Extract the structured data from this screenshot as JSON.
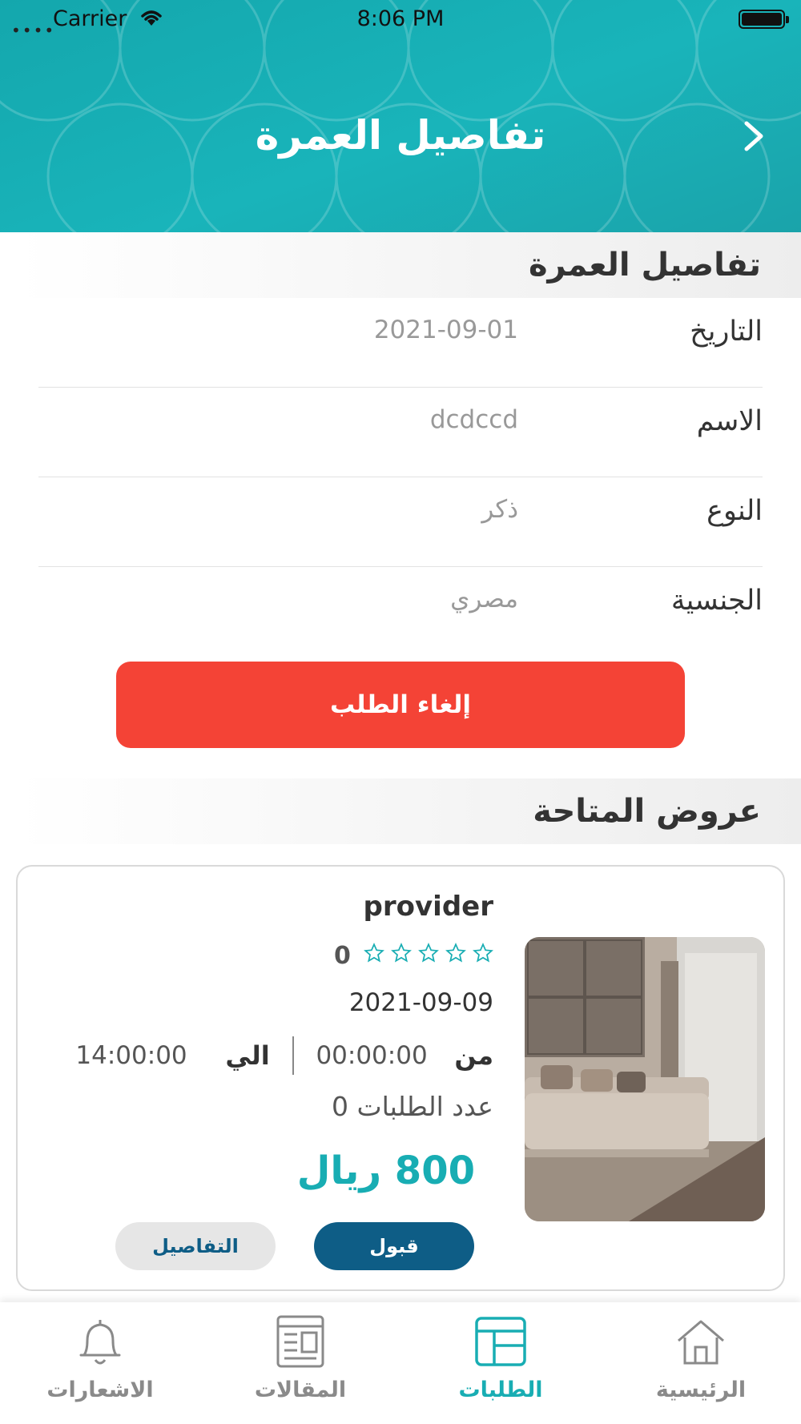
{
  "status_bar": {
    "carrier": "Carrier",
    "time": "8:06 PM"
  },
  "header": {
    "title": "تفاصيل العمرة"
  },
  "details_section": {
    "title": "تفاصيل العمرة",
    "rows": [
      {
        "label": "التاريخ",
        "value": "2021-09-01"
      },
      {
        "label": "الاسم",
        "value": "dcdccd"
      },
      {
        "label": "النوع",
        "value": "ذكر"
      },
      {
        "label": "الجنسية",
        "value": "مصري"
      }
    ],
    "cancel_label": "إلغاء الطلب"
  },
  "offers_section": {
    "title": "عروض المتاحة",
    "offer": {
      "provider": "provider",
      "rating": "0",
      "stars_filled": 0,
      "stars_total": 5,
      "date": "2021-09-09",
      "from_label": "من",
      "from_time": "00:00:00",
      "to_label": "الي",
      "to_time": "14:00:00",
      "requests_count": "عدد الطلبات 0",
      "price": "800 ريال",
      "accept_label": "قبول",
      "details_label": "التفاصيل"
    }
  },
  "tabbar": {
    "items": [
      {
        "label": "الرئيسية",
        "icon": "home-icon",
        "active": false
      },
      {
        "label": "الطلبات",
        "icon": "orders-icon",
        "active": true
      },
      {
        "label": "المقالات",
        "icon": "articles-icon",
        "active": false
      },
      {
        "label": "الاشعارات",
        "icon": "bell-icon",
        "active": false
      }
    ]
  },
  "colors": {
    "teal": "#18adb3",
    "cancel_red": "#f44336",
    "accept_blue": "#0e5d86"
  }
}
